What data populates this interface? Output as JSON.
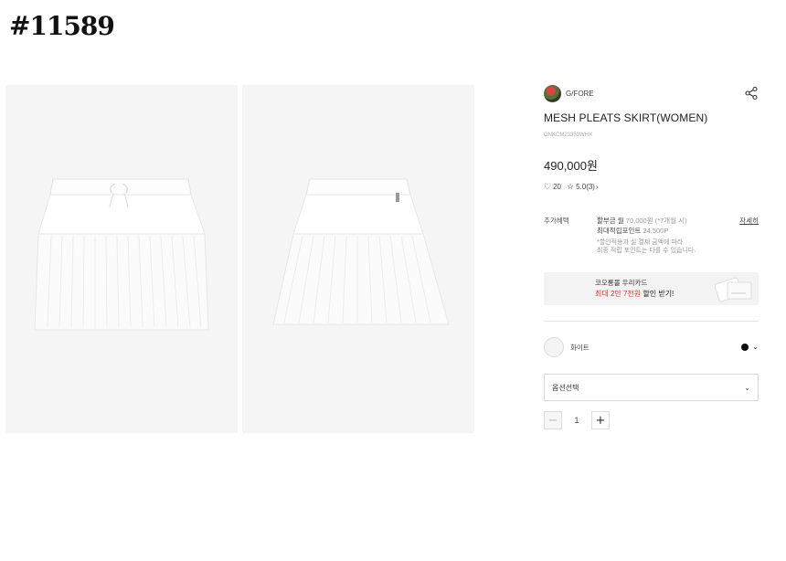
{
  "watermark": "#11589",
  "product": {
    "brand": "G/FORE",
    "title": "MESH PLEATS SKIRT(WOMEN)",
    "sku": "GNKCM23353WHX",
    "price": "490,000원",
    "likes": "20",
    "rating": "5.0",
    "reviews": "(3)"
  },
  "benefit": {
    "label": "추가혜택",
    "installment": "할부금 월",
    "installment_detail": "70,000원 (*7개월 시)",
    "points_label": "최대적립포인트",
    "points_value": "24,500P",
    "note1": "*할인적용과 실 결제 금액에 따라",
    "note2": "최종 적립 포인트는 다를 수 있습니다.",
    "detail_link": "자세히"
  },
  "card_banner": {
    "line1": "코오롱몰 우리카드",
    "line2_highlight": "최대 2만 7천원",
    "line2_rest": "할인 받기!"
  },
  "color": {
    "name": "화이트"
  },
  "option": {
    "placeholder": "옵션선택"
  },
  "quantity": {
    "minus": "−",
    "value": "1",
    "plus": "+"
  },
  "icons": {
    "share": "share-icon",
    "heart": "heart-icon",
    "star": "star-icon"
  }
}
